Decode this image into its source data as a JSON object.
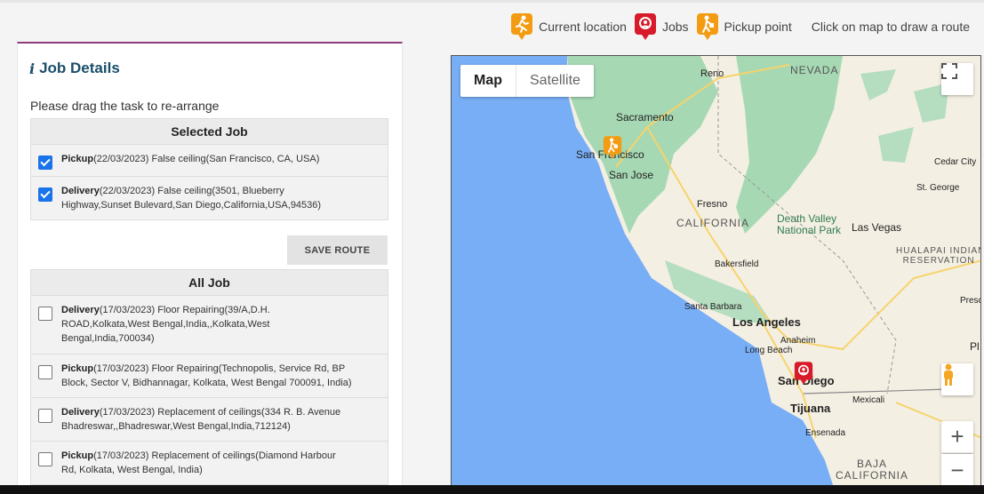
{
  "legend": {
    "current_location": "Current location",
    "jobs": "Jobs",
    "pickup_point": "Pickup point",
    "hint": "Click on map to draw a route"
  },
  "panel": {
    "title": "Job Details",
    "drag_note": "Please drag the task to re-arrange",
    "selected_header": "Selected Job",
    "save_route": "SAVE ROUTE",
    "all_header": "All Job"
  },
  "selected_jobs": [
    {
      "kind": "Pickup",
      "line1": "(22/03/2023) False ceiling(San Francisco, CA, USA)",
      "line2": "",
      "line3": "",
      "checked": true
    },
    {
      "kind": "Delivery",
      "line1": "(22/03/2023) False ceiling(3501, Blueberry",
      "line2": "Highway,Sunset Bulevard,San Diego,California,USA,94536)",
      "line3": "",
      "checked": true
    }
  ],
  "all_jobs": [
    {
      "kind": "Delivery",
      "line1": "(17/03/2023) Floor Repairing(39/A,D.H.",
      "line2": "ROAD,Kolkata,West Bengal,India,,Kolkata,West",
      "line3": "Bengal,India,700034)",
      "checked": false
    },
    {
      "kind": "Pickup",
      "line1": "(17/03/2023) Floor Repairing(Technopolis, Service Rd, BP",
      "line2": "Block, Sector V, Bidhannagar, Kolkata, West Bengal 700091, India)",
      "line3": "",
      "checked": false
    },
    {
      "kind": "Delivery",
      "line1": "(17/03/2023) Replacement of ceilings(334 R. B. Avenue",
      "line2": "Bhadreswar,,Bhadreswar,West Bengal,India,712124)",
      "line3": "",
      "checked": false
    },
    {
      "kind": "Pickup",
      "line1": "(17/03/2023) Replacement of ceilings(Diamond Harbour",
      "line2": "Rd, Kolkata, West Bengal, India)",
      "line3": "",
      "checked": false
    }
  ],
  "map": {
    "type_map": "Map",
    "type_satellite": "Satellite",
    "zoom_in": "+",
    "zoom_out": "−",
    "labels": {
      "reno": "Reno",
      "nevada": "NEVADA",
      "sacramento": "Sacramento",
      "san_francisco": "San Francisco",
      "san_jose": "San Jose",
      "fresno": "Fresno",
      "california": "CALIFORNIA",
      "death_valley": "Death Valley",
      "national_park": "National Park",
      "las_vegas": "Las Vegas",
      "cedar_city": "Cedar City",
      "st_george": "St. George",
      "hualapai": "HUALAPAI INDIAN",
      "reservation": "RESERVATION",
      "bakersfield": "Bakersfield",
      "santa_barbara": "Santa Barbara",
      "los_angeles": "Los Angeles",
      "anaheim": "Anaheim",
      "long_beach": "Long Beach",
      "san_diego": "San Diego",
      "tijuana": "Tijuana",
      "mexicali": "Mexicali",
      "ensenada": "Ensenada",
      "baja": "BAJA",
      "baja_california": "CALIFORNIA",
      "presc": "Presc",
      "ph": "Pl"
    }
  },
  "colors": {
    "accent_border": "#8e3b7e",
    "title": "#1a4e6b",
    "marker_orange": "#f39c12",
    "marker_red": "#d81b2a",
    "water": "#78aef5",
    "land": "#f4efe3",
    "forest": "#a6d8b4"
  }
}
